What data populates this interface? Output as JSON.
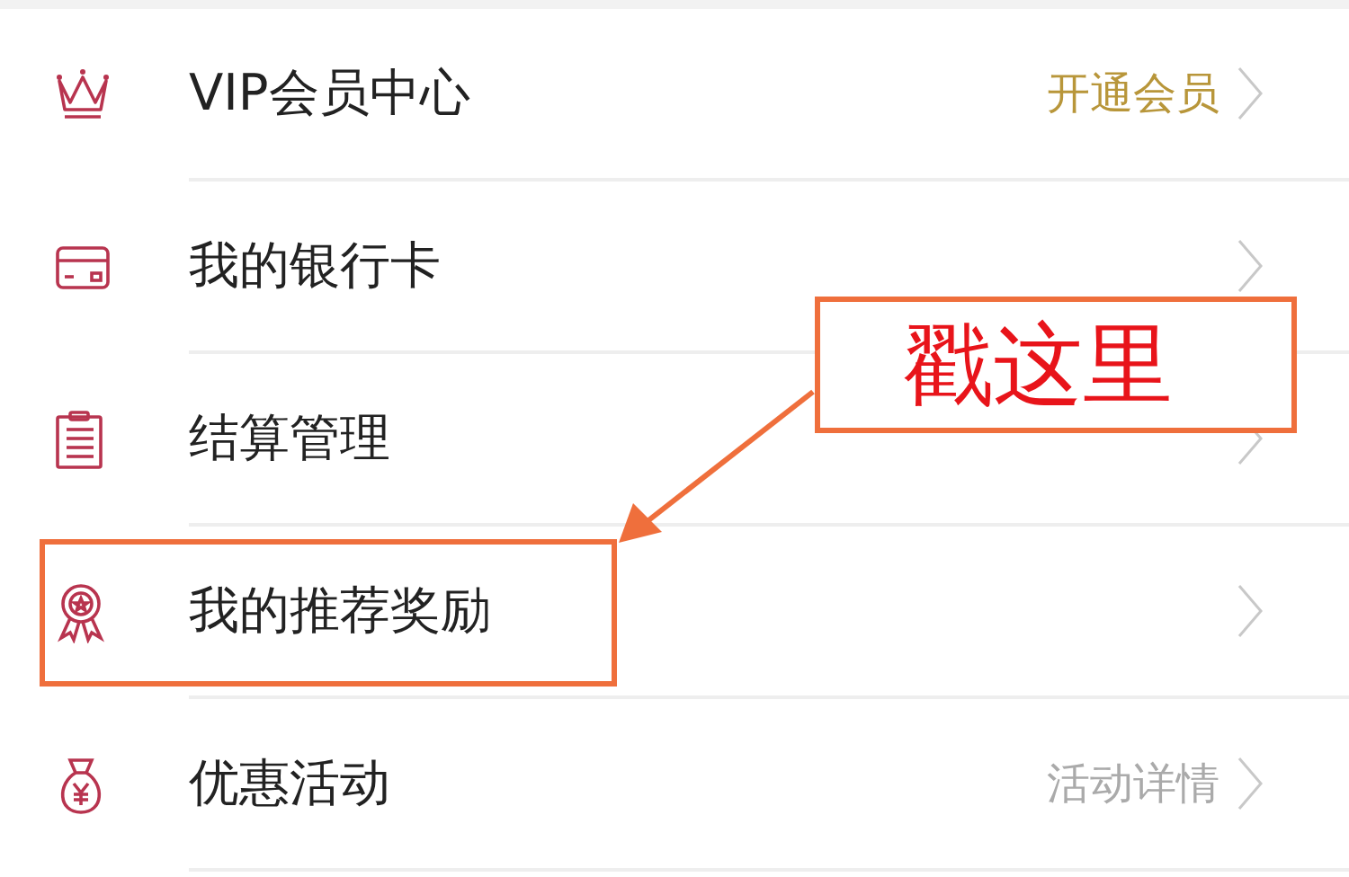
{
  "menu": [
    {
      "label": "VIP会员中心",
      "detail": "开通会员",
      "detail_highlighted": true,
      "annotated": false
    },
    {
      "label": "我的银行卡",
      "annotated": false
    },
    {
      "label": "结算管理",
      "annotated": false
    },
    {
      "label": "我的推荐奖励",
      "annotated": true
    },
    {
      "label": "优惠活动",
      "detail": "活动详情",
      "detail_highlighted": false,
      "annotated": false
    }
  ],
  "callout": {
    "text": "戳这里"
  }
}
